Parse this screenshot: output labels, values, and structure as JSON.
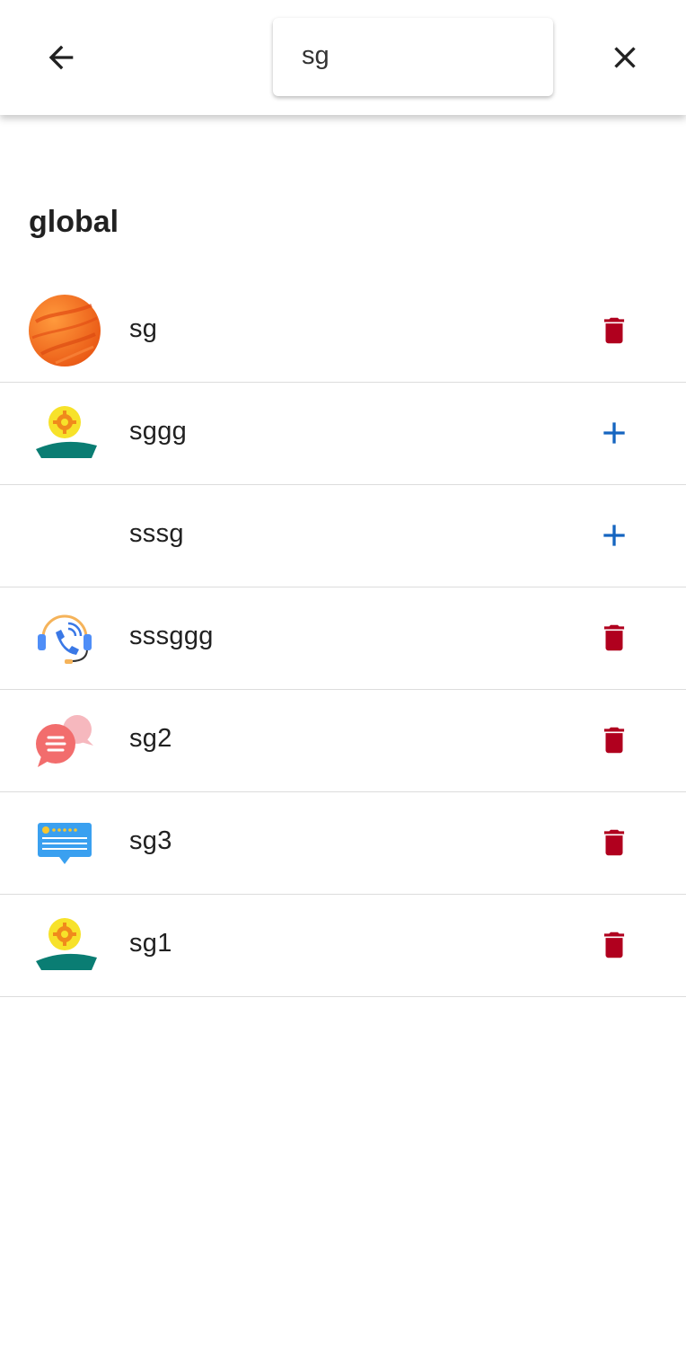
{
  "search": {
    "value": "sg"
  },
  "section": {
    "title": "global"
  },
  "colors": {
    "delete": "#b0001e",
    "add": "#1565c0",
    "icon": "#212121"
  },
  "items": [
    {
      "label": "sg",
      "avatar": "orange-planet-icon",
      "action": "delete"
    },
    {
      "label": "sggg",
      "avatar": "gear-sun-island-icon",
      "action": "add"
    },
    {
      "label": "sssg",
      "avatar": "",
      "action": "add"
    },
    {
      "label": "sssggg",
      "avatar": "headset-phone-icon",
      "action": "delete"
    },
    {
      "label": "sg2",
      "avatar": "chat-bubbles-icon",
      "action": "delete"
    },
    {
      "label": "sg3",
      "avatar": "rating-card-icon",
      "action": "delete"
    },
    {
      "label": "sg1",
      "avatar": "gear-sun-island-icon",
      "action": "delete"
    }
  ]
}
